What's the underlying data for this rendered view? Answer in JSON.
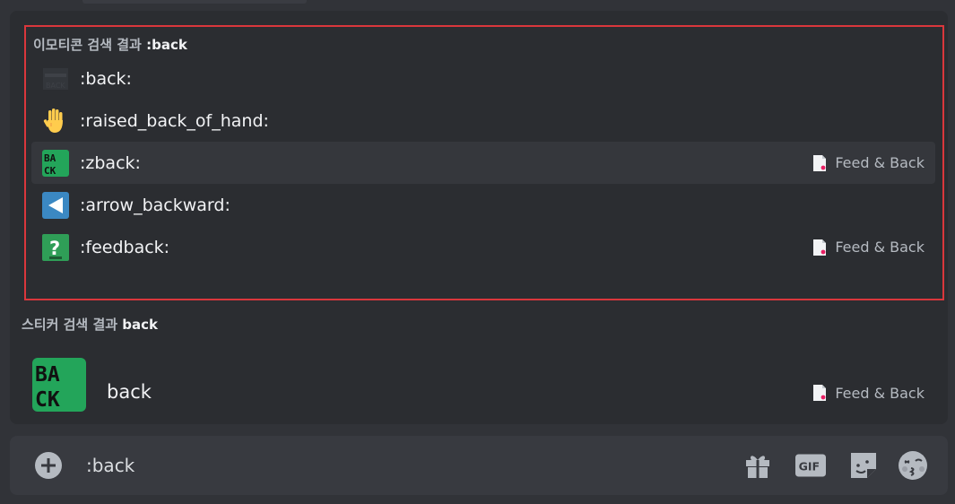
{
  "emoji_results": {
    "header_prefix": "이모티콘 검색 결과",
    "query": ":back",
    "items": [
      {
        "name": ":back:",
        "icon": "back-arrow-icon",
        "source": "",
        "selected": false
      },
      {
        "name": ":raised_back_of_hand:",
        "icon": "raised-back-of-hand-icon",
        "source": "",
        "selected": false
      },
      {
        "name": ":zback:",
        "icon": "zback-icon",
        "source": "Feed & Back",
        "selected": true
      },
      {
        "name": ":arrow_backward:",
        "icon": "arrow-backward-icon",
        "source": "",
        "selected": false
      },
      {
        "name": ":feedback:",
        "icon": "feedback-icon",
        "source": "Feed & Back",
        "selected": false
      }
    ]
  },
  "sticker_results": {
    "header_prefix": "스티커 검색 결과",
    "query": "back",
    "items": [
      {
        "name": "back",
        "icon": "back-sticker",
        "source": "Feed & Back"
      }
    ]
  },
  "composer": {
    "text": ":back",
    "tools": [
      "gift-icon",
      "gif-icon",
      "sticker-icon",
      "emoji-icon"
    ],
    "gif_label": "GIF"
  },
  "colors": {
    "background": "#313338",
    "panel": "#2b2d31",
    "selected_row": "#35373c",
    "highlight_border": "#da373c",
    "composer": "#383a40",
    "accent_green": "#23a55a"
  }
}
